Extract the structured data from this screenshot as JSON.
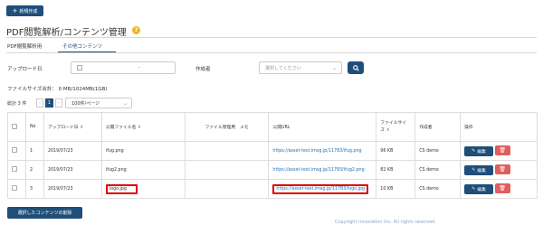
{
  "toolbar": {
    "new_label": "新規作成"
  },
  "page": {
    "title": "PDF閲覧解析/コンテンツ管理",
    "help_icon": "?"
  },
  "tabs": [
    {
      "label": "PDF閲覧解析用"
    },
    {
      "label": "その他コンテンツ"
    }
  ],
  "filters": {
    "upload_date_label": "アップロード日",
    "date_range_sep": "-",
    "creator_label": "作成者",
    "creator_placeholder": "選択してください"
  },
  "summary": {
    "filesize_total": "ファイルサイズ合計： 0 MB/1024MB(1GB)"
  },
  "pagination": {
    "total_label": "総計 3 件",
    "prev": "‹",
    "current_page": "1",
    "next": "›",
    "per_page": "100件/ページ"
  },
  "table": {
    "headers": {
      "no": "No",
      "upload_date": "アップロード日",
      "public_filename": "公開ファイル名",
      "admin_memo": "ファイル管理用　メモ",
      "public_url": "公開URL",
      "filesize_line1": "ファイルサイ",
      "filesize_line2": "ズ",
      "creator": "作成者",
      "actions": "操作"
    },
    "edit_label": "編集",
    "rows": [
      {
        "no": "1",
        "date": "2019/07/23",
        "filename": "ifug.png",
        "memo": "",
        "url": "https://asset-test.imsg.jp/11783/ifug.png",
        "size": "96 KB",
        "creator": "CS demo"
      },
      {
        "no": "2",
        "date": "2019/07/23",
        "filename": "ifug2.png",
        "memo": "",
        "url": "https://asset-test.imsg.jp/11783/ifug2.png",
        "size": "82 KB",
        "creator": "CS demo"
      },
      {
        "no": "3",
        "date": "2019/07/23",
        "filename": "logo.jpg",
        "memo": "",
        "url": "https://asset-test.imsg.jp/11783/logo.jpg",
        "size": "10 KB",
        "creator": "CS demo"
      }
    ]
  },
  "bulk": {
    "delete_label": "選択したコンテンツの削除"
  },
  "footer": {
    "copyright": "Copyright Innovation Inc. All rights reserved."
  },
  "colors": {
    "primary": "#1f4e79",
    "danger": "#e35d5d",
    "highlight": "#e00000",
    "link": "#1f6fb5"
  }
}
